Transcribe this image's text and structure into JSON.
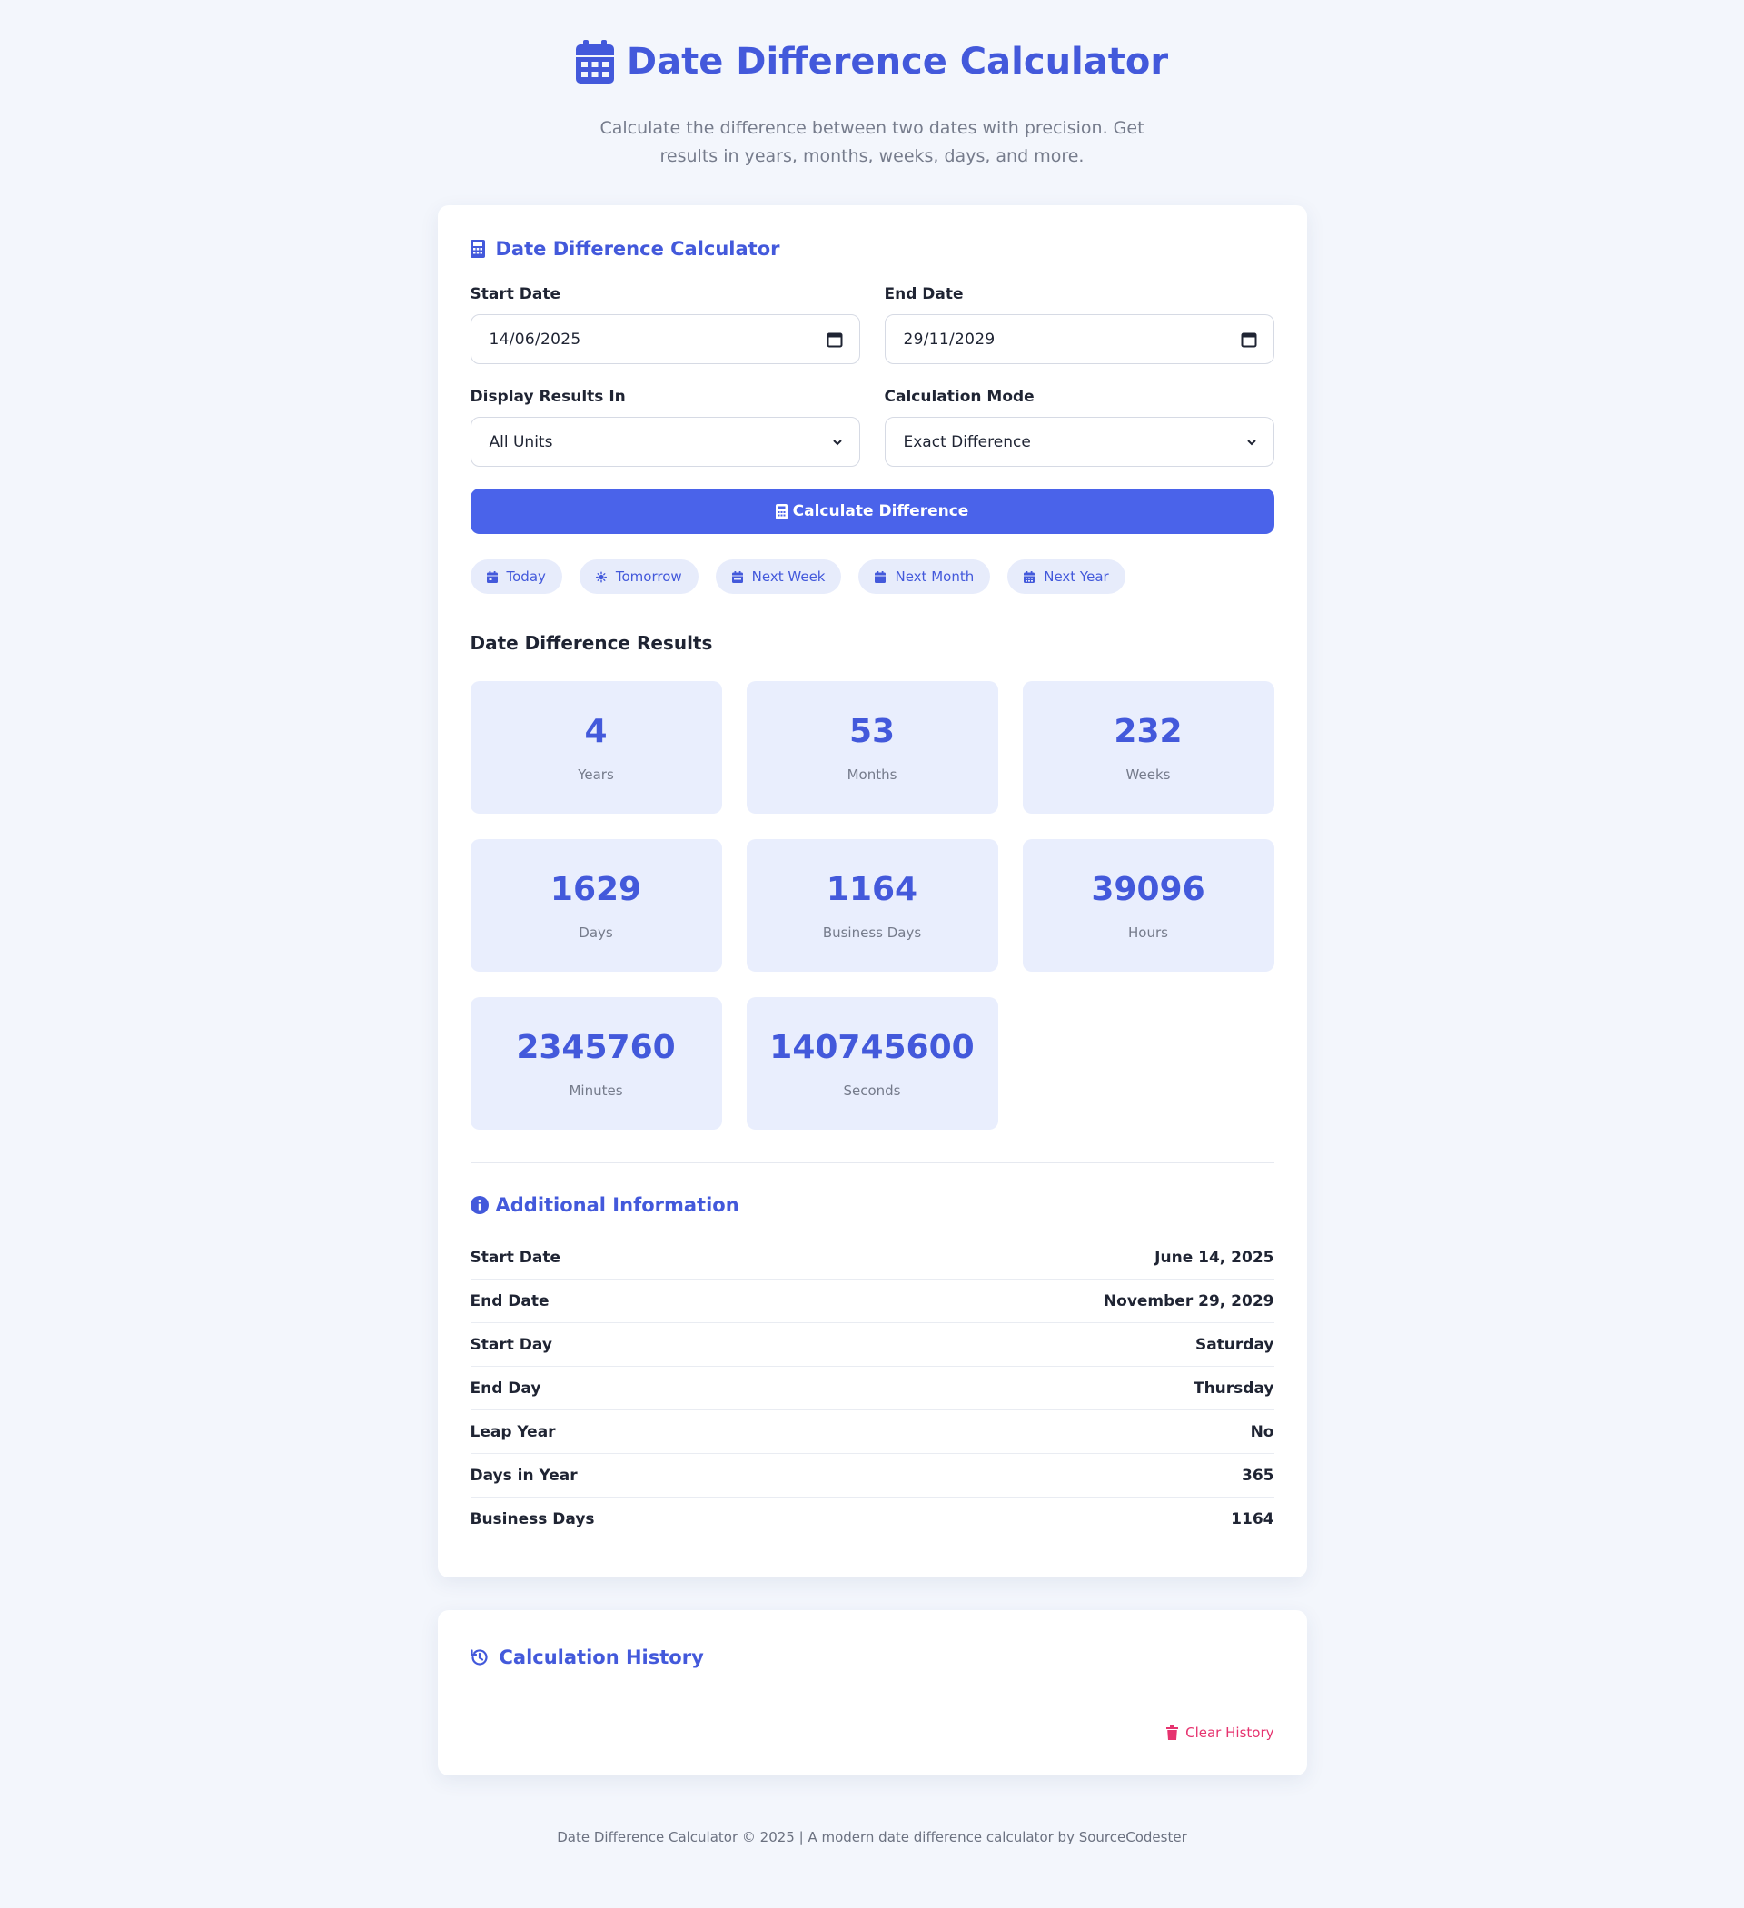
{
  "header": {
    "title": "Date Difference Calculator",
    "subtitle": "Calculate the difference between two dates with precision. Get results in years, months, weeks, days, and more."
  },
  "calculator": {
    "title": "Date Difference Calculator",
    "start_date": {
      "label": "Start Date",
      "value": "14/06/2025"
    },
    "end_date": {
      "label": "End Date",
      "value": "29/11/2029"
    },
    "display_in": {
      "label": "Display Results In",
      "selected": "All Units"
    },
    "mode": {
      "label": "Calculation Mode",
      "selected": "Exact Difference"
    },
    "calculate_label": "Calculate Difference",
    "quick_buttons": [
      "Today",
      "Tomorrow",
      "Next Week",
      "Next Month",
      "Next Year"
    ]
  },
  "results": {
    "title": "Date Difference Results",
    "items": [
      {
        "value": "4",
        "label": "Years"
      },
      {
        "value": "53",
        "label": "Months"
      },
      {
        "value": "232",
        "label": "Weeks"
      },
      {
        "value": "1629",
        "label": "Days"
      },
      {
        "value": "1164",
        "label": "Business Days"
      },
      {
        "value": "39096",
        "label": "Hours"
      },
      {
        "value": "2345760",
        "label": "Minutes"
      },
      {
        "value": "140745600",
        "label": "Seconds"
      }
    ]
  },
  "additional_info": {
    "title": "Additional Information",
    "rows": [
      {
        "label": "Start Date",
        "value": "June 14, 2025"
      },
      {
        "label": "End Date",
        "value": "November 29, 2029"
      },
      {
        "label": "Start Day",
        "value": "Saturday"
      },
      {
        "label": "End Day",
        "value": "Thursday"
      },
      {
        "label": "Leap Year",
        "value": "No"
      },
      {
        "label": "Days in Year",
        "value": "365"
      },
      {
        "label": "Business Days",
        "value": "1164"
      }
    ]
  },
  "history": {
    "title": "Calculation History",
    "clear_label": "Clear History"
  },
  "footer": {
    "text": "Date Difference Calculator © 2025 | A modern date difference calculator by SourceCodester"
  },
  "colors": {
    "accent": "#4359db",
    "button": "#4a63ea",
    "result_bg": "#e9eefd",
    "danger": "#e6336f",
    "page_bg": "#f3f6fc"
  },
  "icons": {
    "header": "calendar-icon",
    "calculator": "calculator-icon",
    "info": "info-circle-icon",
    "history": "history-icon",
    "clear": "trash-icon",
    "date_field": "calendar-icon",
    "quick": [
      "calendar-day-icon",
      "sun-icon",
      "calendar-week-icon",
      "calendar-month-icon",
      "calendar-year-icon"
    ]
  }
}
